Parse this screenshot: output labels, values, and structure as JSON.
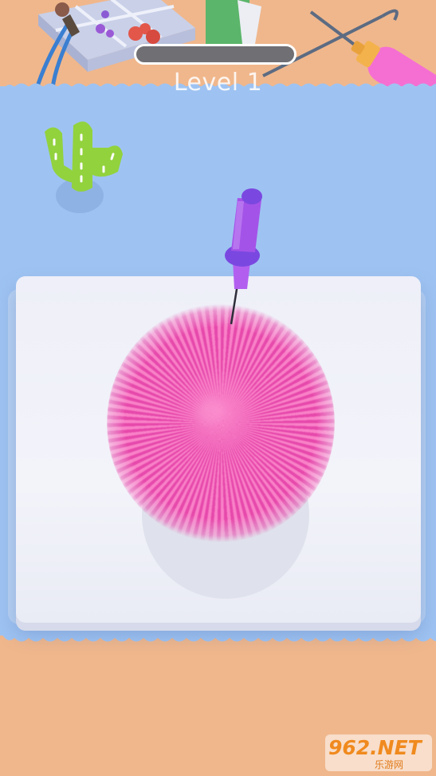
{
  "hud": {
    "level_label": "Level 1",
    "progress_fraction": 0.0
  },
  "colors": {
    "mat": "#9ec3f2",
    "tabletop": "#f0b78c",
    "yarn": "#ee5eb0",
    "needle_tool": "#a453e8",
    "progress_fill": "#f06bc2"
  },
  "scene_objects": {
    "needle_tool": "felting-needle-icon",
    "cactus": "cactus-ornament-icon",
    "bead_tray": "bead-organizer-icon",
    "scissors": "scissors-icon",
    "glue": "glue-tube-icon",
    "pliers": "pliers-icon"
  },
  "watermark": {
    "text": "962.NET",
    "subtext": "乐游网"
  }
}
